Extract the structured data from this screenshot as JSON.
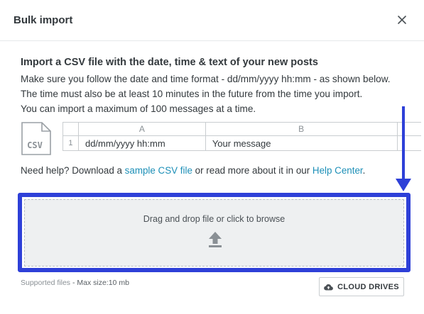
{
  "modal": {
    "title": "Bulk import",
    "close_icon": "close-icon"
  },
  "instructions": {
    "heading": "Import a CSV file with the date, time & text of your new posts",
    "lines": [
      "Make sure you follow the date and time format - dd/mm/yyyy hh:mm - as shown below.",
      "The time must also be at least 10 minutes in the future from the time you import.",
      "You can import a maximum of 100 messages at a time."
    ]
  },
  "csv_example": {
    "icon": "csv-file-icon",
    "icon_label": "CSV",
    "column_headers": [
      "A",
      "B"
    ],
    "row_number": "1",
    "cells": [
      "dd/mm/yyyy hh:mm",
      "Your message"
    ]
  },
  "help": {
    "prefix": "Need help? Download a ",
    "sample_link": "sample CSV file",
    "middle": " or read more about it in our ",
    "help_center_link": "Help Center",
    "suffix": "."
  },
  "dropzone": {
    "label": "Drag and drop file or click to browse",
    "icon": "upload-icon"
  },
  "footer": {
    "supported_label": "Supported files",
    "max_size": " - Max size:10 mb",
    "cloud_button_label": "CLOUD DRIVES",
    "cloud_icon": "cloud-upload-icon"
  },
  "colors": {
    "annotation_blue": "#2e40d8",
    "link": "#1c8fb7",
    "text": "#33393d"
  }
}
